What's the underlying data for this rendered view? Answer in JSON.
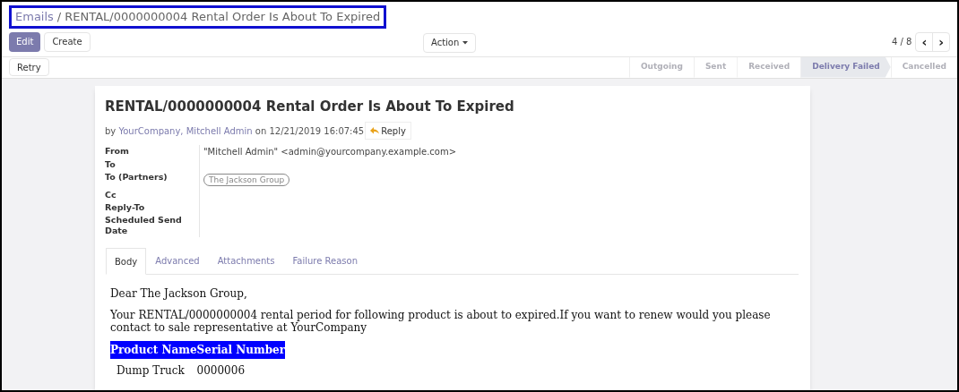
{
  "breadcrumb": {
    "items": [
      {
        "label": "Emails",
        "link": true
      },
      {
        "label": "RENTAL/0000000004 Rental Order Is About To Expired",
        "link": false
      }
    ],
    "separator": "/"
  },
  "toolbar": {
    "buttons": [
      {
        "label": "Edit",
        "primary": true
      },
      {
        "label": "Create",
        "primary": false
      }
    ],
    "action": "Action",
    "pager": "4 / 8",
    "prev": "‹",
    "next": "›"
  },
  "header_buttons": [
    "Retry"
  ],
  "stages": [
    {
      "label": "Outgoing",
      "selected": false
    },
    {
      "label": "Sent",
      "selected": false
    },
    {
      "label": "Received",
      "selected": false
    },
    {
      "label": "Delivery Failed",
      "selected": true
    },
    {
      "label": "Cancelled",
      "selected": false
    }
  ],
  "message": {
    "subject": "RENTAL/0000000004 Rental Order Is About To Expired",
    "byline": {
      "prefix": "by",
      "authors": "YourCompany, Mitchell Admin",
      "date": "on 12/21/2019 16:07:45"
    },
    "reply": "Reply",
    "fields": [
      {
        "label": "From",
        "kind": "text",
        "value": "\"Mitchell Admin\" <admin@yourcompany.example.com>"
      },
      {
        "label": "To",
        "kind": "empty"
      },
      {
        "label": "To (Partners)",
        "kind": "tag",
        "value": "The Jackson Group"
      },
      {
        "label": "Cc",
        "kind": "empty"
      },
      {
        "label": "Reply-To",
        "kind": "empty"
      },
      {
        "label": "Scheduled Send Date",
        "kind": "empty"
      }
    ]
  },
  "tabs": [
    {
      "label": "Body",
      "selected": true
    },
    {
      "label": "Advanced",
      "selected": false
    },
    {
      "label": "Attachments",
      "selected": false
    },
    {
      "label": "Failure Reason",
      "selected": false
    }
  ],
  "body": {
    "greeting": "Dear The Jackson Group,",
    "paragraph": "Your RENTAL/0000000004 rental period for following product is about to expired.If you want to renew would you please contact to sale representative at YourCompany",
    "table": {
      "columns": [
        "Product Name",
        "Serial Number"
      ],
      "rows": [
        [
          "Dump Truck",
          "0000006"
        ]
      ]
    }
  }
}
